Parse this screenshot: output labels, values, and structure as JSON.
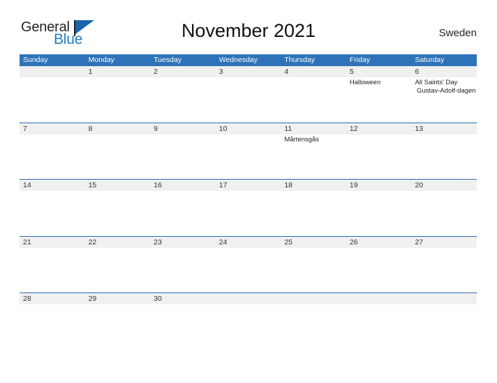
{
  "brand": {
    "name_part1": "General",
    "name_part2": "Blue",
    "flag_icon": "blue-flag-icon"
  },
  "header": {
    "title": "November 2021",
    "country": "Sweden"
  },
  "colors": {
    "header_blue": "#2e73b8",
    "row_rule_blue": "#2a6bb0",
    "date_band_gray": "#f0f0f0",
    "brand_blue": "#1f7cc0",
    "text_dark": "#231f20"
  },
  "calendar": {
    "weekdays": [
      "Sunday",
      "Monday",
      "Tuesday",
      "Wednesday",
      "Thursday",
      "Friday",
      "Saturday"
    ],
    "weeks": [
      [
        {
          "day": "",
          "events": []
        },
        {
          "day": "1",
          "events": []
        },
        {
          "day": "2",
          "events": []
        },
        {
          "day": "3",
          "events": []
        },
        {
          "day": "4",
          "events": []
        },
        {
          "day": "5",
          "events": [
            "Halloween"
          ]
        },
        {
          "day": "6",
          "events": [
            "All Saints' Day",
            " Gustav-Adolf-dagen"
          ]
        }
      ],
      [
        {
          "day": "7",
          "events": []
        },
        {
          "day": "8",
          "events": []
        },
        {
          "day": "9",
          "events": []
        },
        {
          "day": "10",
          "events": []
        },
        {
          "day": "11",
          "events": [
            "Mårtensgås"
          ]
        },
        {
          "day": "12",
          "events": []
        },
        {
          "day": "13",
          "events": []
        }
      ],
      [
        {
          "day": "14",
          "events": []
        },
        {
          "day": "15",
          "events": []
        },
        {
          "day": "16",
          "events": []
        },
        {
          "day": "17",
          "events": []
        },
        {
          "day": "18",
          "events": []
        },
        {
          "day": "19",
          "events": []
        },
        {
          "day": "20",
          "events": []
        }
      ],
      [
        {
          "day": "21",
          "events": []
        },
        {
          "day": "22",
          "events": []
        },
        {
          "day": "23",
          "events": []
        },
        {
          "day": "24",
          "events": []
        },
        {
          "day": "25",
          "events": []
        },
        {
          "day": "26",
          "events": []
        },
        {
          "day": "27",
          "events": []
        }
      ],
      [
        {
          "day": "28",
          "events": []
        },
        {
          "day": "29",
          "events": []
        },
        {
          "day": "30",
          "events": []
        },
        {
          "day": "",
          "events": []
        },
        {
          "day": "",
          "events": []
        },
        {
          "day": "",
          "events": []
        },
        {
          "day": "",
          "events": []
        }
      ]
    ]
  }
}
